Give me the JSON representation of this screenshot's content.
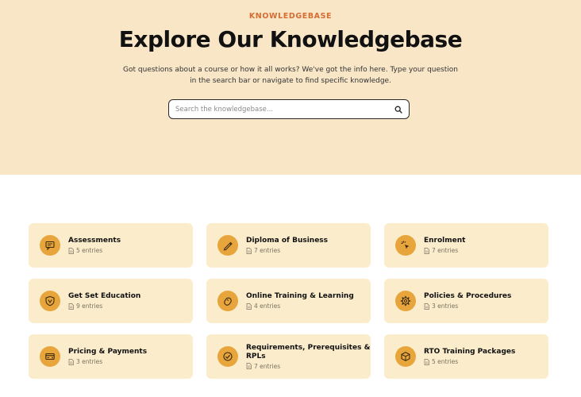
{
  "hero": {
    "eyebrow": "KNOWLEDGEBASE",
    "title": "Explore Our Knowledgebase",
    "subtitle_line1": "Got questions about a course or how it all works? We've got the info here. Type your question",
    "subtitle_line2": "in the search bar or navigate to find specific knowledge."
  },
  "search": {
    "placeholder": "Search the knowledgebase...",
    "icon": "search-icon"
  },
  "colors": {
    "hero_bg": "#f8e6c7",
    "accent": "#d76c31",
    "card_bg": "#fbedcc",
    "icon_bg": "#e8a53c"
  },
  "categories": [
    {
      "title": "Assessments",
      "entries": "5 entries",
      "icon": "chat-bubble-icon"
    },
    {
      "title": "Diploma of Business",
      "entries": "7 entries",
      "icon": "pen-icon"
    },
    {
      "title": "Enrolment",
      "entries": "7 entries",
      "icon": "cursor-click-icon"
    },
    {
      "title": "Get Set Education",
      "entries": "9 entries",
      "icon": "shield-icon"
    },
    {
      "title": "Online Training & Learning",
      "entries": "4 entries",
      "icon": "mouse-icon"
    },
    {
      "title": "Policies & Procedures",
      "entries": "3 entries",
      "icon": "gear-icon"
    },
    {
      "title": "Pricing & Payments",
      "entries": "3 entries",
      "icon": "credit-card-icon"
    },
    {
      "title_line1": "Requirements, Prerequisites &",
      "title_line2": "RPLs",
      "entries": "7 entries",
      "icon": "check-circle-icon"
    },
    {
      "title": "RTO Training Packages",
      "entries": "5 entries",
      "icon": "package-icon"
    }
  ]
}
